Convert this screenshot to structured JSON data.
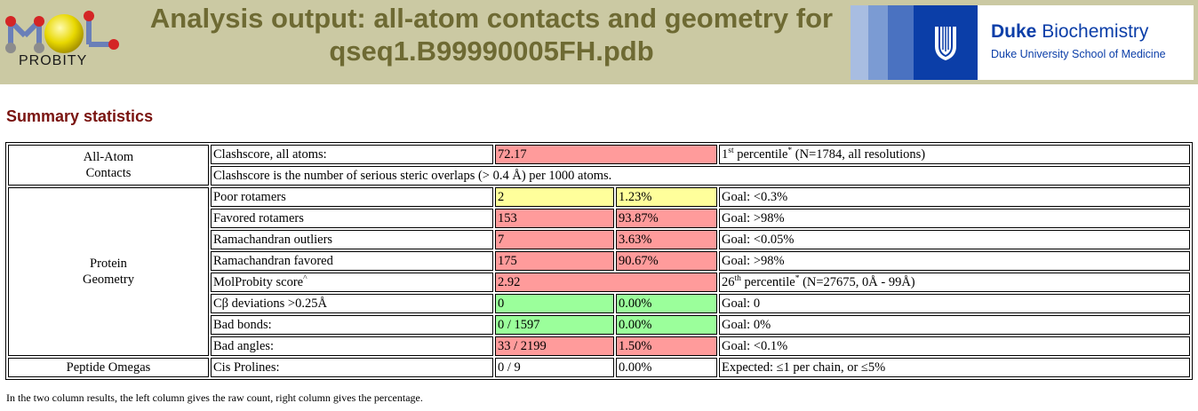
{
  "header": {
    "logo_text": "PROBITY",
    "title_line1": "Analysis output: all-atom contacts and geometry for",
    "title_line2": "qseq1.B99990005FH.pdb",
    "duke_brand_bold": "Duke",
    "duke_brand_rest": " Biochemistry",
    "duke_sub": "Duke University School of Medicine"
  },
  "section_title": "Summary statistics",
  "table": {
    "all_atom": {
      "label_line1": "All-Atom",
      "label_line2": "Contacts",
      "clash_label": "Clashscore, all atoms:",
      "clash_value": "72.17",
      "clash_pct_num": "1",
      "clash_pct_sup": "st",
      "clash_pct_word": " percentile",
      "clash_pct_star": "*",
      "clash_pct_rest": " (N=1784, all resolutions)",
      "clash_note": "Clashscore is the number of serious steric overlaps (> 0.4 Å) per 1000 atoms."
    },
    "protein": {
      "label_line1": "Protein",
      "label_line2": "Geometry",
      "rows": [
        {
          "label": "Poor rotamers",
          "count": "2",
          "pct": "1.23%",
          "goal": "Goal: <0.3%"
        },
        {
          "label": "Favored rotamers",
          "count": "153",
          "pct": "93.87%",
          "goal": "Goal: >98%"
        },
        {
          "label": "Ramachandran outliers",
          "count": "7",
          "pct": "3.63%",
          "goal": "Goal: <0.05%"
        },
        {
          "label": "Ramachandran favored",
          "count": "175",
          "pct": "90.67%",
          "goal": "Goal: >98%"
        }
      ],
      "molprobity": {
        "label": "MolProbity score",
        "label_sup": "^",
        "value": "2.92",
        "pct_num": "26",
        "pct_sup": "th",
        "pct_word": " percentile",
        "pct_star": "*",
        "pct_rest": " (N=27675, 0Å - 99Å)"
      },
      "rows2": [
        {
          "label": "Cβ deviations >0.25Å",
          "count": "0",
          "pct": "0.00%",
          "goal": "Goal: 0"
        },
        {
          "label": "Bad bonds:",
          "count": "0 / 1597",
          "pct": "0.00%",
          "goal": "Goal: 0%"
        },
        {
          "label": "Bad angles:",
          "count": "33 / 2199",
          "pct": "1.50%",
          "goal": "Goal: <0.1%"
        }
      ]
    },
    "peptide": {
      "label": "Peptide Omegas",
      "row_label": "Cis Prolines:",
      "count": "0 / 9",
      "pct": "0.00%",
      "goal": "Expected: ≤1 per chain, or ≤5%"
    }
  },
  "footer": {
    "line1": "In the two column results, the left column gives the raw count, right column gives the percentage."
  },
  "colors": {
    "header_bg": "#cbc9a3",
    "title": "#6e6a33",
    "section_title": "#7a1410",
    "bad": "#ff9b9b",
    "warn": "#ffff9b",
    "good": "#9bff9b",
    "duke_blue": "#0b3ea8"
  }
}
